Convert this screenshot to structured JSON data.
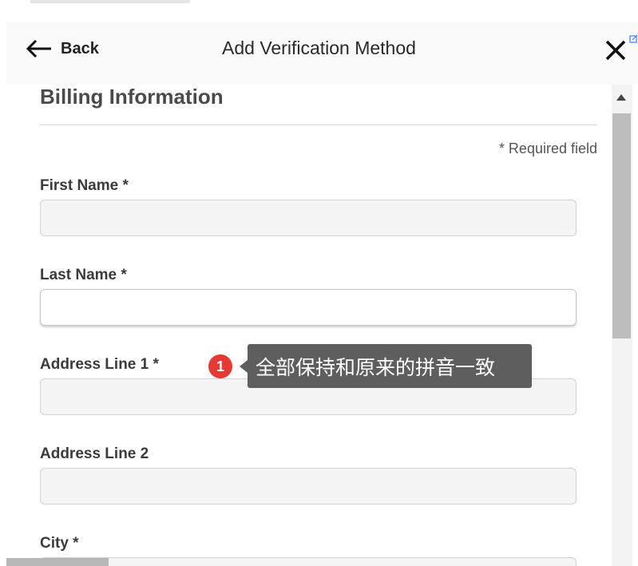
{
  "header": {
    "back_label": "Back",
    "title": "Add Verification Method"
  },
  "form": {
    "section_title": "Billing Information",
    "required_note": "* Required field",
    "fields": [
      {
        "label": "First Name *",
        "value": ""
      },
      {
        "label": "Last Name *",
        "value": ""
      },
      {
        "label": "Address Line 1 *",
        "value": ""
      },
      {
        "label": "Address Line 2",
        "value": ""
      },
      {
        "label": "City *",
        "value": ""
      }
    ]
  },
  "annotation": {
    "number": "1",
    "text": "全部保持和原来的拼音一致"
  },
  "icons": [
    "back-arrow-icon",
    "close-icon",
    "external-link-icon",
    "scroll-up-arrow-icon"
  ],
  "colors": {
    "badge": "#e53935",
    "tooltip": "#5e5e5e",
    "input_background": "#f4f4f4"
  }
}
